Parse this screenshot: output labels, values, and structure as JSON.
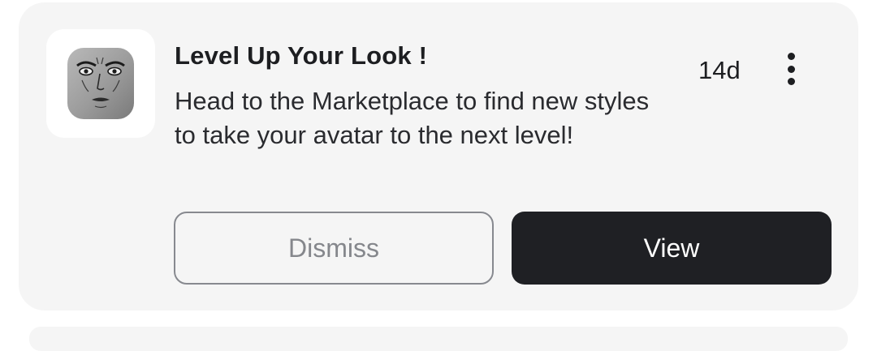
{
  "notification": {
    "thumbnail_icon": "avatar-head-icon",
    "title": "Level Up Your Look !",
    "body": "Head to the Marketplace to find new styles to take your avatar to the next level!",
    "age": "14d",
    "menu_icon": "more-vertical-icon"
  },
  "actions": {
    "dismiss_label": "Dismiss",
    "view_label": "View"
  },
  "colors": {
    "card_background": "#f5f5f5",
    "primary_button": "#1f2024",
    "primary_text": "#1d1e21",
    "secondary_border": "#87898f"
  }
}
